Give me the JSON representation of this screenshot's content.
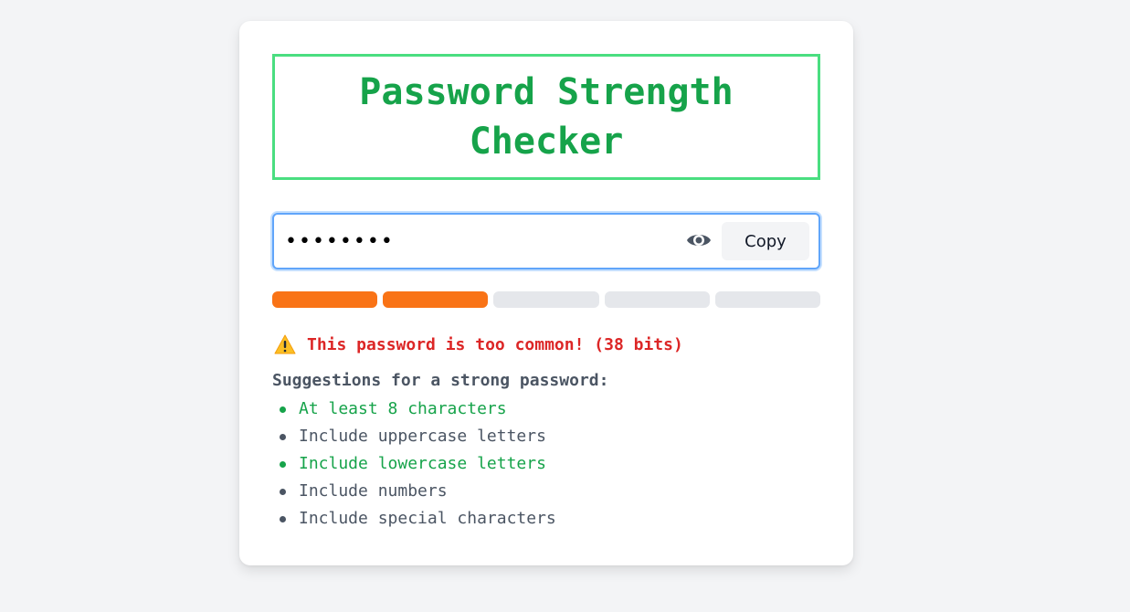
{
  "title": "Password Strength Checker",
  "password": {
    "masked_value": "••••••••",
    "visibility_icon": "eye-icon",
    "copy_label": "Copy"
  },
  "strength_meter": {
    "segments_total": 5,
    "segments_filled": 2,
    "fill_color": "#f97316",
    "empty_color": "#e5e7eb"
  },
  "warning": {
    "icon": "warning-icon",
    "text": "This password is too common! (38 bits)"
  },
  "suggestions": {
    "heading": "Suggestions for a strong password:",
    "items": [
      {
        "text": "At least 8 characters",
        "met": true
      },
      {
        "text": "Include uppercase letters",
        "met": false
      },
      {
        "text": "Include lowercase letters",
        "met": true
      },
      {
        "text": "Include numbers",
        "met": false
      },
      {
        "text": "Include special characters",
        "met": false
      }
    ]
  },
  "colors": {
    "accent_green": "#16a34a",
    "title_border": "#4ade80",
    "warning_red": "#dc2626",
    "focus_blue": "#60a5fa"
  }
}
